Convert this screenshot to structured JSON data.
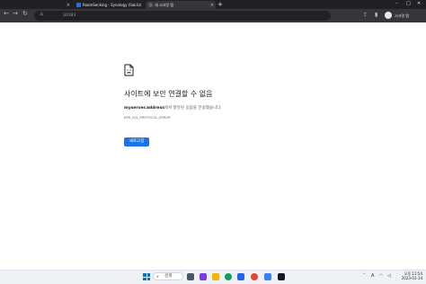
{
  "tabs": [
    {
      "title": "",
      "active": false
    },
    {
      "title": "RoamSecking - Synology (Sakli...",
      "active": false,
      "favicon_color": "#1a73e8"
    },
    {
      "title": "새 시크릿 탭",
      "active": true
    }
  ],
  "toolbar": {
    "url": "30183"
  },
  "profile": {
    "label": "시크릿 탭"
  },
  "error": {
    "title": "사이트에 보안 연결할 수 없음",
    "desc_host": "myserver.address",
    "desc_rest": "에서 잘못된 응답을 전송했습니다.",
    "code": "ERR_SSL_PROTOCOL_ERROR",
    "reload_label": "새로고침"
  },
  "taskbar": {
    "search_label": "검색",
    "clock_time": "오후 11:54",
    "clock_date": "2023-03-14",
    "lang": "A"
  },
  "colors": {
    "accent": "#1a73e8",
    "chrome_dark": "#202124",
    "toolbar": "#35363a"
  }
}
